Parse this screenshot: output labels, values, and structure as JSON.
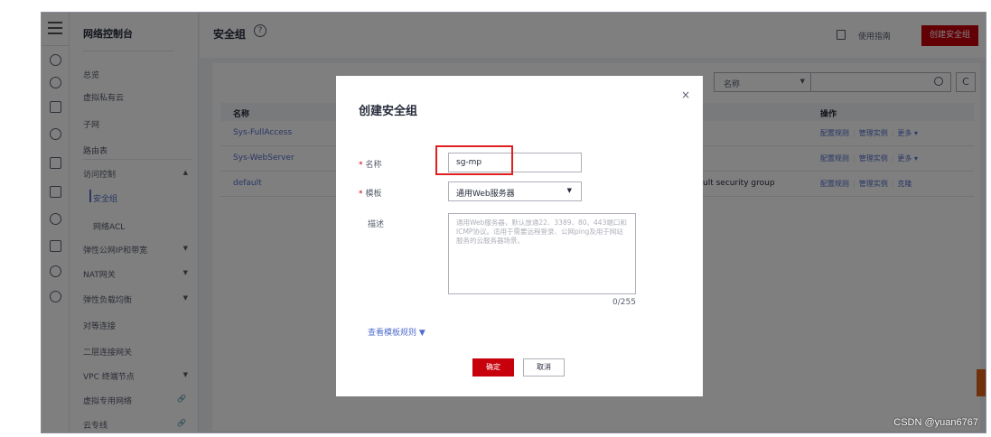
{
  "sidebar": {
    "title": "网络控制台",
    "items": [
      {
        "label": "总览",
        "caret": false
      },
      {
        "label": "虚拟私有云",
        "caret": false
      },
      {
        "label": "子网",
        "caret": false
      },
      {
        "label": "路由表",
        "caret": false
      },
      {
        "label": "访问控制",
        "caret": true,
        "caret_glyph": "▲"
      },
      {
        "label": "安全组",
        "sub": true,
        "active": true
      },
      {
        "label": "网络ACL",
        "sub": true
      },
      {
        "label": "弹性公网IP和带宽",
        "caret": true,
        "caret_glyph": "▼"
      },
      {
        "label": "NAT网关",
        "caret": true,
        "caret_glyph": "▼"
      },
      {
        "label": "弹性负载均衡",
        "caret": true,
        "caret_glyph": "▼"
      },
      {
        "label": "对等连接"
      },
      {
        "label": "二层连接网关"
      },
      {
        "label": "VPC 终端节点",
        "caret": true,
        "caret_glyph": "▼"
      },
      {
        "label": "虚拟专用网络",
        "link": true
      },
      {
        "label": "云专线",
        "link": true
      }
    ]
  },
  "header": {
    "title": "安全组",
    "help_glyph": "?",
    "guide_label": "使用指南",
    "create_label": "创建安全组"
  },
  "search": {
    "select_value": "名称",
    "caret_glyph": "▼",
    "refresh_glyph": "C"
  },
  "table": {
    "col_name": "名称",
    "col_ops": "操作",
    "rows": [
      {
        "name": "Sys-FullAccess",
        "desc": "",
        "ops": [
          "配置规则",
          "管理实例",
          "更多 ▾"
        ]
      },
      {
        "name": "Sys-WebServer",
        "desc": "",
        "ops": [
          "配置规则",
          "管理实例",
          "更多 ▾"
        ]
      },
      {
        "name": "default",
        "desc": "ult security group",
        "ops": [
          "配置规则",
          "管理实例",
          "克隆"
        ]
      }
    ]
  },
  "dialog": {
    "title": "创建安全组",
    "close_glyph": "×",
    "required_mark": "*",
    "name_label": "名称",
    "name_value": "sg-mp",
    "template_label": "模板",
    "template_value": "通用Web服务器",
    "template_caret": "▼",
    "desc_label": "描述",
    "desc_placeholder": "通用Web服务器，默认放通22、3389、80、443端口和ICMP协议。适用于需要远程登录、公网ping及用于网站服务的云服务器场景。",
    "counter": "0/255",
    "view_rules_label": "查看模板规则 ▼",
    "ok_label": "确定",
    "cancel_label": "取消"
  },
  "watermark": "CSDN @yuan6767",
  "colors": {
    "accent": "#c7000b",
    "link": "#526ecc",
    "highlight_box": "#e02020"
  }
}
